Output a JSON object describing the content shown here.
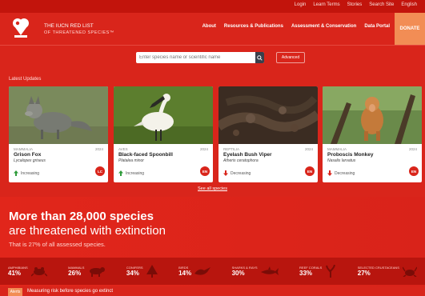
{
  "utility": {
    "links": [
      "Login",
      "Learn Terms",
      "Stories",
      "Search Site",
      "English"
    ]
  },
  "header": {
    "title_line1": "THE IUCN RED LIST",
    "title_line2": "OF THREATENED SPECIES™",
    "nav": [
      "About",
      "Resources & Publications",
      "Assessment & Conservation",
      "Data Portal"
    ],
    "donate": "DONATE"
  },
  "search": {
    "placeholder": "Enter species name or scientific name",
    "advanced_label": "Advanced"
  },
  "featured": {
    "label": "Latest Updates",
    "see_more": "See all species",
    "cards": [
      {
        "name": "Grison Fox",
        "scientific": "Lycalopex griseus",
        "meta": "MAMMALIA",
        "year": "2024",
        "trend": "Increasing",
        "trend_dir": "up",
        "status": "LC"
      },
      {
        "name": "Black-faced Spoonbill",
        "scientific": "Platalea minor",
        "meta": "AVES",
        "year": "2024",
        "trend": "Increasing",
        "trend_dir": "up",
        "status": "EN"
      },
      {
        "name": "Eyelash Bush Viper",
        "scientific": "Atheris ceratophora",
        "meta": "REPTILIA",
        "year": "2024",
        "trend": "Decreasing",
        "trend_dir": "down",
        "status": "EN"
      },
      {
        "name": "Proboscis Monkey",
        "scientific": "Nasalis larvatus",
        "meta": "MAMMALIA",
        "year": "2024",
        "trend": "Decreasing",
        "trend_dir": "down",
        "status": "EN"
      }
    ]
  },
  "threat": {
    "headline": "More than 28,000 species",
    "subheadline": "are threatened with extinction",
    "note": "That is 27% of all assessed species.",
    "stats": [
      {
        "name": "AMPHIBIANS",
        "pct": "41%",
        "icon": "frog-icon"
      },
      {
        "name": "MAMMALS",
        "pct": "26%",
        "icon": "mammal-icon"
      },
      {
        "name": "CONIFERS",
        "pct": "34%",
        "icon": "conifer-icon"
      },
      {
        "name": "BIRDS",
        "pct": "14%",
        "icon": "bird-icon"
      },
      {
        "name": "SHARKS & RAYS",
        "pct": "30%",
        "icon": "shark-icon"
      },
      {
        "name": "REEF CORALS",
        "pct": "33%",
        "icon": "coral-icon"
      },
      {
        "name": "SELECTED CRUSTACEANS",
        "pct": "27%",
        "icon": "crab-icon"
      }
    ]
  },
  "bottom": {
    "tag": "Alerts",
    "message": "Measuring risk before species go extinct"
  }
}
